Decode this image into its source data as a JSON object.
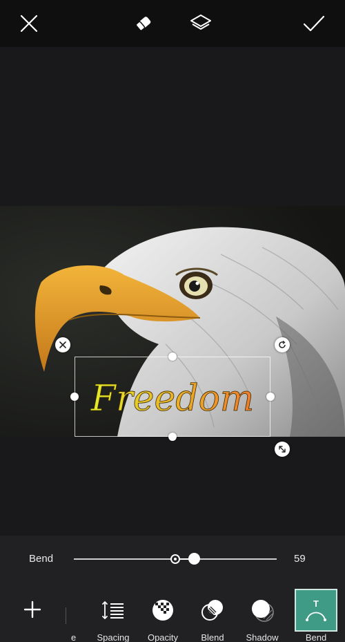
{
  "topbar": {
    "close_icon": "close-icon",
    "eraser_icon": "eraser-icon",
    "layers_icon": "layers-icon",
    "apply_icon": "check-icon"
  },
  "text_layer": {
    "text": "Freedom",
    "colors": {
      "start": "#e3ec2a",
      "end": "#f07a2a"
    }
  },
  "slider": {
    "label": "Bend",
    "value": "59",
    "value_fraction": 0.59
  },
  "tools": [
    {
      "label": "e",
      "icon": "size-icon",
      "partial": true
    },
    {
      "label": "Spacing",
      "icon": "spacing-icon"
    },
    {
      "label": "Opacity",
      "icon": "opacity-icon"
    },
    {
      "label": "Blend",
      "icon": "blend-icon"
    },
    {
      "label": "Shadow",
      "icon": "shadow-icon"
    },
    {
      "label": "Bend",
      "icon": "bend-icon",
      "active": true
    }
  ],
  "colors": {
    "accent": "#3f9a86",
    "background": "#1b1b1e"
  }
}
